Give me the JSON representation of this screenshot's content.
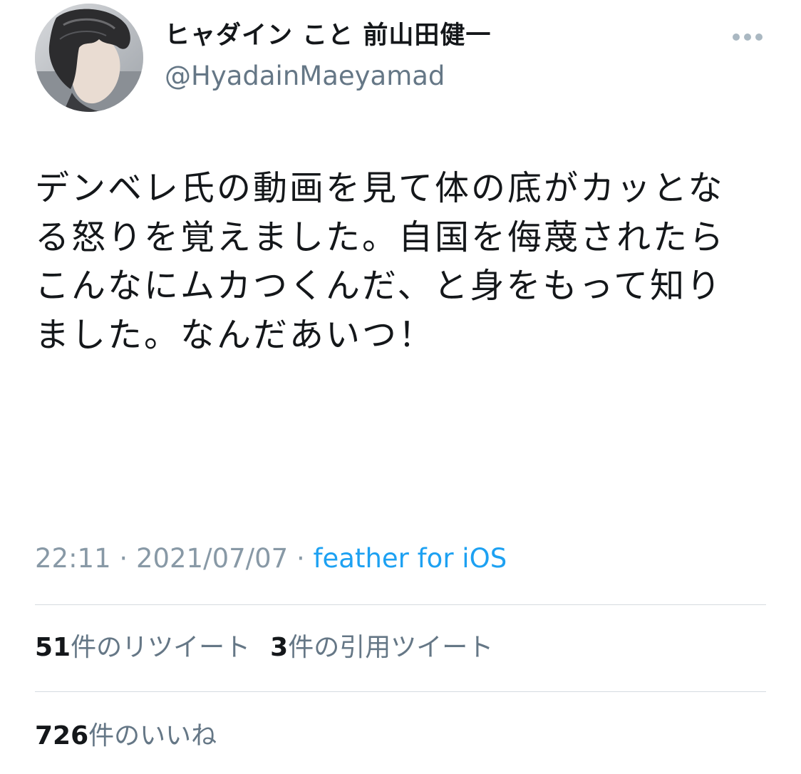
{
  "author": {
    "display_name": "ヒャダイン こと 前山田健一",
    "handle": "@HyadainMaeyamad",
    "avatar_icon": "avatar-photo"
  },
  "menu": {
    "more_icon": "more-horizontal-icon"
  },
  "tweet": {
    "text": "デンベレ氏の動画を見て体の底がカッとなる怒りを覚えました。自国を侮蔑されたらこんなにムカつくんだ、と身をもって知りました。なんだあいつ！",
    "time": "22:11",
    "separator": " · ",
    "date": "2021/07/07",
    "source": "feather for iOS"
  },
  "stats": {
    "retweets_count": "51",
    "retweets_label": "件のリツイート",
    "quotes_count": "3",
    "quotes_label": "件の引用ツイート",
    "likes_count": "726",
    "likes_label": "件のいいね"
  },
  "colors": {
    "text_primary": "#14171a",
    "text_secondary": "#657786",
    "meta_gray": "#8899a6",
    "link_blue": "#1da1f2",
    "divider": "#d5dbe0"
  }
}
